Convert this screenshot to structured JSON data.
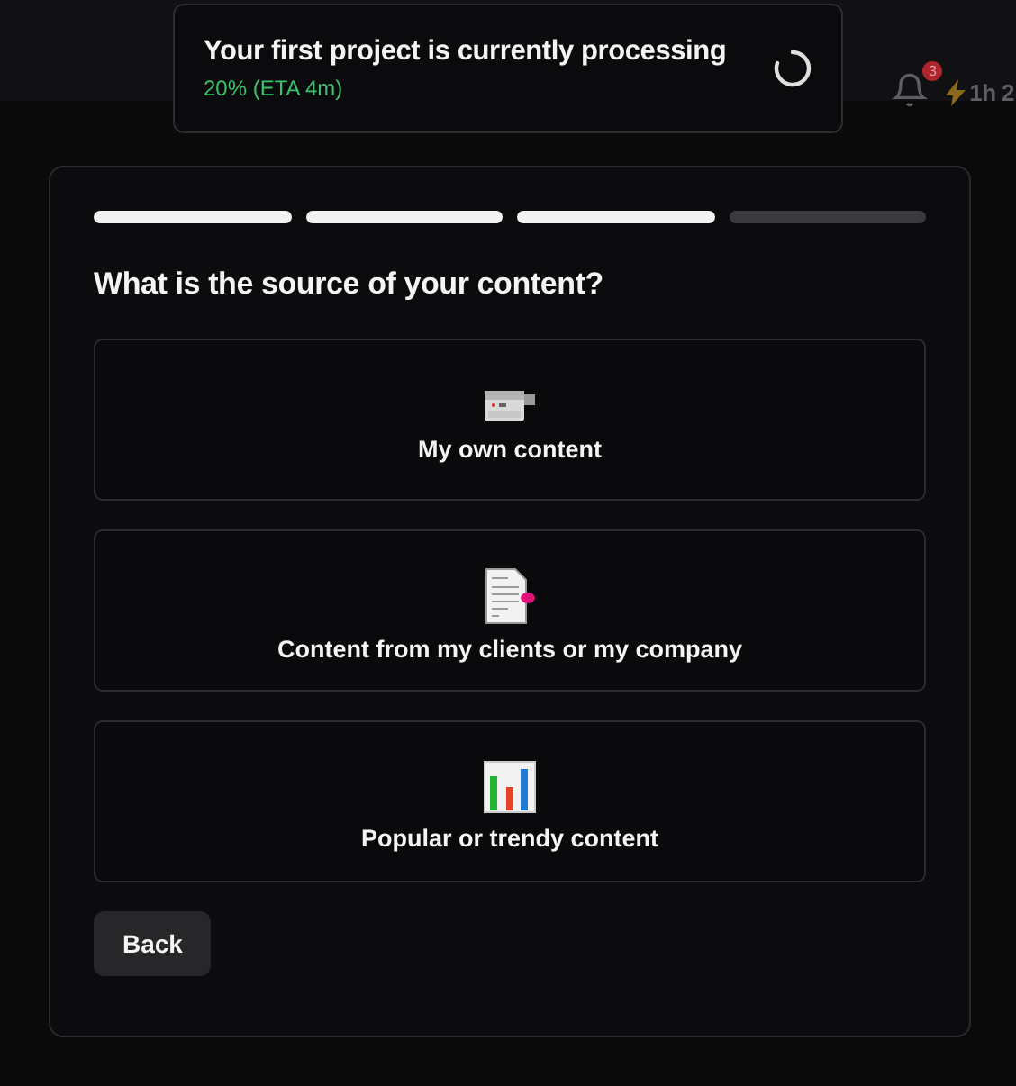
{
  "toast": {
    "title": "Your first project is currently processing",
    "progress": "20% (ETA 4m)",
    "in_progress": true
  },
  "header": {
    "notification_count": "3",
    "credits": "1h 2"
  },
  "dialog": {
    "steps": [
      {
        "done": true
      },
      {
        "done": true
      },
      {
        "done": true
      },
      {
        "done": false
      }
    ],
    "question": "What is the source of your content?",
    "options": [
      {
        "kind": "camera",
        "label": "My own content"
      },
      {
        "kind": "document",
        "label": "Content from my clients or my company"
      },
      {
        "kind": "chart",
        "label": "Popular or trendy content"
      }
    ],
    "back_button": "Back"
  }
}
